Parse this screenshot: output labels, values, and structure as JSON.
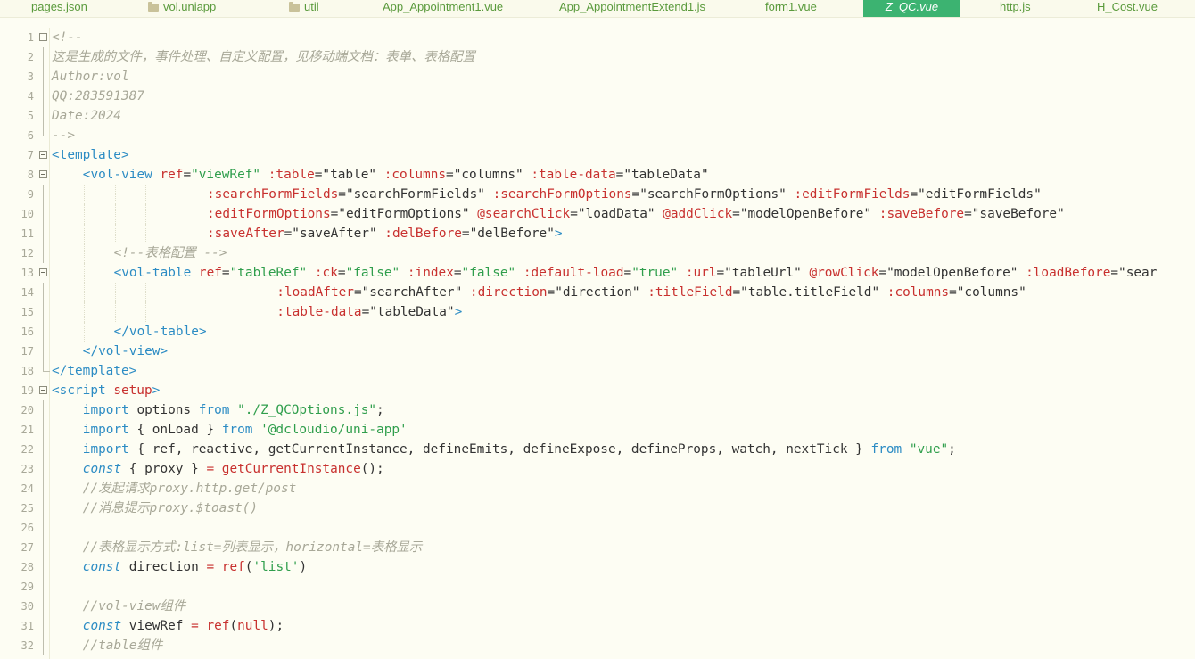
{
  "tabs": [
    {
      "label": "pages.json",
      "folder": false,
      "active": false
    },
    {
      "label": "vol.uniapp",
      "folder": true,
      "active": false
    },
    {
      "label": "util",
      "folder": true,
      "active": false
    },
    {
      "label": "App_Appointment1.vue",
      "folder": false,
      "active": false
    },
    {
      "label": "App_AppointmentExtend1.js",
      "folder": false,
      "active": false
    },
    {
      "label": "form1.vue",
      "folder": false,
      "active": false
    },
    {
      "label": "Z_QC.vue",
      "folder": false,
      "active": true
    },
    {
      "label": "http.js",
      "folder": false,
      "active": false
    },
    {
      "label": "H_Cost.vue",
      "folder": false,
      "active": false
    }
  ],
  "colors": {
    "background": "#FDFDF3",
    "tab_text": "#5A9A3C",
    "active_tab": "#3CB371",
    "comment": "#A8A898",
    "tag": "#2C8CC4",
    "attribute": "#C8312F",
    "string": "#2F9E4C"
  },
  "code_lines": [
    {
      "n": "1",
      "fold": "open",
      "indent": 0,
      "tokens": [
        [
          "com",
          "<!--"
        ]
      ]
    },
    {
      "n": "2",
      "fold": "line",
      "indent": 0,
      "tokens": [
        [
          "com",
          "这是生成的文件，事件处理、自定义配置，见移动端文档：表单、表格配置"
        ]
      ]
    },
    {
      "n": "3",
      "fold": "line",
      "indent": 0,
      "tokens": [
        [
          "com",
          "Author:vol"
        ]
      ]
    },
    {
      "n": "4",
      "fold": "line",
      "indent": 0,
      "tokens": [
        [
          "com",
          "QQ:283591387"
        ]
      ]
    },
    {
      "n": "5",
      "fold": "line",
      "indent": 0,
      "tokens": [
        [
          "com",
          "Date:2024"
        ]
      ]
    },
    {
      "n": "6",
      "fold": "end",
      "indent": 0,
      "tokens": [
        [
          "com",
          "-->"
        ]
      ]
    },
    {
      "n": "7",
      "fold": "open",
      "indent": 0,
      "tokens": [
        [
          "tag",
          "<template>"
        ]
      ]
    },
    {
      "n": "8",
      "fold": "open",
      "indent": 1,
      "tokens": [
        [
          "tag",
          "<vol-view "
        ],
        [
          "attr",
          "ref"
        ],
        [
          "plain",
          "="
        ],
        [
          "str",
          "\"viewRef\""
        ],
        [
          "plain",
          " "
        ],
        [
          "attr",
          ":table"
        ],
        [
          "plain",
          "=\"table\" "
        ],
        [
          "attr",
          ":columns"
        ],
        [
          "plain",
          "=\"columns\" "
        ],
        [
          "attr",
          ":table-data"
        ],
        [
          "plain",
          "=\"tableData\""
        ]
      ]
    },
    {
      "n": "9",
      "fold": "line",
      "indent": 5,
      "tokens": [
        [
          "attr",
          ":searchFormFields"
        ],
        [
          "plain",
          "=\"searchFormFields\" "
        ],
        [
          "attr",
          ":searchFormOptions"
        ],
        [
          "plain",
          "=\"searchFormOptions\" "
        ],
        [
          "attr",
          ":editFormFields"
        ],
        [
          "plain",
          "=\"editFormFields\""
        ]
      ]
    },
    {
      "n": "10",
      "fold": "line",
      "indent": 5,
      "tokens": [
        [
          "attr",
          ":editFormOptions"
        ],
        [
          "plain",
          "=\"editFormOptions\" "
        ],
        [
          "attr",
          "@searchClick"
        ],
        [
          "plain",
          "=\"loadData\" "
        ],
        [
          "attr",
          "@addClick"
        ],
        [
          "plain",
          "=\"modelOpenBefore\" "
        ],
        [
          "attr",
          ":saveBefore"
        ],
        [
          "plain",
          "=\"saveBefore\""
        ]
      ]
    },
    {
      "n": "11",
      "fold": "line",
      "indent": 5,
      "tokens": [
        [
          "attr",
          ":saveAfter"
        ],
        [
          "plain",
          "=\"saveAfter\" "
        ],
        [
          "attr",
          ":delBefore"
        ],
        [
          "plain",
          "=\"delBefore\""
        ],
        [
          "tag",
          ">"
        ]
      ]
    },
    {
      "n": "12",
      "fold": "line",
      "indent": 2,
      "tokens": [
        [
          "com",
          "<!--表格配置 -->"
        ]
      ]
    },
    {
      "n": "13",
      "fold": "open",
      "indent": 2,
      "tokens": [
        [
          "tag",
          "<vol-table "
        ],
        [
          "attr",
          "ref"
        ],
        [
          "plain",
          "="
        ],
        [
          "str",
          "\"tableRef\""
        ],
        [
          "plain",
          " "
        ],
        [
          "attr",
          ":ck"
        ],
        [
          "plain",
          "="
        ],
        [
          "str",
          "\"false\""
        ],
        [
          "plain",
          " "
        ],
        [
          "attr",
          ":index"
        ],
        [
          "plain",
          "="
        ],
        [
          "str",
          "\"false\""
        ],
        [
          "plain",
          " "
        ],
        [
          "attr",
          ":default-load"
        ],
        [
          "plain",
          "="
        ],
        [
          "str",
          "\"true\""
        ],
        [
          "plain",
          " "
        ],
        [
          "attr",
          ":url"
        ],
        [
          "plain",
          "=\"tableUrl\" "
        ],
        [
          "attr",
          "@rowClick"
        ],
        [
          "plain",
          "=\"modelOpenBefore\" "
        ],
        [
          "attr",
          ":loadBefore"
        ],
        [
          "plain",
          "=\"sear"
        ]
      ]
    },
    {
      "n": "14",
      "fold": "line",
      "indent": 5,
      "extra": 9,
      "tokens": [
        [
          "attr",
          ":loadAfter"
        ],
        [
          "plain",
          "=\"searchAfter\" "
        ],
        [
          "attr",
          ":direction"
        ],
        [
          "plain",
          "=\"direction\" "
        ],
        [
          "attr",
          ":titleField"
        ],
        [
          "plain",
          "=\"table.titleField\" "
        ],
        [
          "attr",
          ":columns"
        ],
        [
          "plain",
          "=\"columns\""
        ]
      ]
    },
    {
      "n": "15",
      "fold": "line",
      "indent": 5,
      "extra": 9,
      "tokens": [
        [
          "attr",
          ":table-data"
        ],
        [
          "plain",
          "=\"tableData\""
        ],
        [
          "tag",
          ">"
        ]
      ]
    },
    {
      "n": "16",
      "fold": "line",
      "indent": 2,
      "tokens": [
        [
          "tag",
          "</vol-table>"
        ]
      ]
    },
    {
      "n": "17",
      "fold": "line",
      "indent": 1,
      "tokens": [
        [
          "tag",
          "</vol-view>"
        ]
      ]
    },
    {
      "n": "18",
      "fold": "end",
      "indent": 0,
      "tokens": [
        [
          "tag",
          "</template>"
        ]
      ]
    },
    {
      "n": "19",
      "fold": "open",
      "indent": 0,
      "tokens": [
        [
          "tag",
          "<script "
        ],
        [
          "attr",
          "setup"
        ],
        [
          "tag",
          ">"
        ]
      ]
    },
    {
      "n": "20",
      "fold": "line",
      "indent": 1,
      "tokens": [
        [
          "kw",
          "import"
        ],
        [
          "plain",
          " options "
        ],
        [
          "kw",
          "from"
        ],
        [
          "plain",
          " "
        ],
        [
          "str",
          "\"./Z_QCOptions.js\""
        ],
        [
          "plain",
          ";"
        ]
      ]
    },
    {
      "n": "21",
      "fold": "line",
      "indent": 1,
      "tokens": [
        [
          "kw",
          "import"
        ],
        [
          "plain",
          " { onLoad } "
        ],
        [
          "kw",
          "from"
        ],
        [
          "plain",
          " "
        ],
        [
          "str",
          "'@dcloudio/uni-app'"
        ]
      ]
    },
    {
      "n": "22",
      "fold": "line",
      "indent": 1,
      "tokens": [
        [
          "kw",
          "import"
        ],
        [
          "plain",
          " { ref, reactive, getCurrentInstance, defineEmits, defineExpose, defineProps, watch, nextTick } "
        ],
        [
          "kw",
          "from"
        ],
        [
          "plain",
          " "
        ],
        [
          "str",
          "\"vue\""
        ],
        [
          "plain",
          ";"
        ]
      ]
    },
    {
      "n": "23",
      "fold": "line",
      "indent": 1,
      "tokens": [
        [
          "kwi",
          "const"
        ],
        [
          "plain",
          " { proxy } "
        ],
        [
          "op",
          "="
        ],
        [
          "plain",
          " "
        ],
        [
          "fn",
          "getCurrentInstance"
        ],
        [
          "plain",
          "();"
        ]
      ]
    },
    {
      "n": "24",
      "fold": "line",
      "indent": 1,
      "tokens": [
        [
          "com",
          "//发起请求proxy.http.get/post"
        ]
      ]
    },
    {
      "n": "25",
      "fold": "line",
      "indent": 1,
      "tokens": [
        [
          "com",
          "//消息提示proxy.$toast()"
        ]
      ]
    },
    {
      "n": "26",
      "fold": "line",
      "indent": 0,
      "tokens": []
    },
    {
      "n": "27",
      "fold": "line",
      "indent": 1,
      "tokens": [
        [
          "com",
          "//表格显示方式:list=列表显示，horizontal=表格显示"
        ]
      ]
    },
    {
      "n": "28",
      "fold": "line",
      "indent": 1,
      "tokens": [
        [
          "kwi",
          "const"
        ],
        [
          "plain",
          " direction "
        ],
        [
          "op",
          "="
        ],
        [
          "plain",
          " "
        ],
        [
          "fn",
          "ref"
        ],
        [
          "plain",
          "("
        ],
        [
          "str",
          "'list'"
        ],
        [
          "plain",
          ")"
        ]
      ]
    },
    {
      "n": "29",
      "fold": "line",
      "indent": 0,
      "tokens": []
    },
    {
      "n": "30",
      "fold": "line",
      "indent": 1,
      "tokens": [
        [
          "com",
          "//vol-view组件"
        ]
      ]
    },
    {
      "n": "31",
      "fold": "line",
      "indent": 1,
      "tokens": [
        [
          "kwi",
          "const"
        ],
        [
          "plain",
          " viewRef "
        ],
        [
          "op",
          "="
        ],
        [
          "plain",
          " "
        ],
        [
          "fn",
          "ref"
        ],
        [
          "plain",
          "("
        ],
        [
          "lit",
          "null"
        ],
        [
          "plain",
          ");"
        ]
      ]
    },
    {
      "n": "32",
      "fold": "line",
      "indent": 1,
      "tokens": [
        [
          "com",
          "//table组件"
        ]
      ]
    }
  ]
}
